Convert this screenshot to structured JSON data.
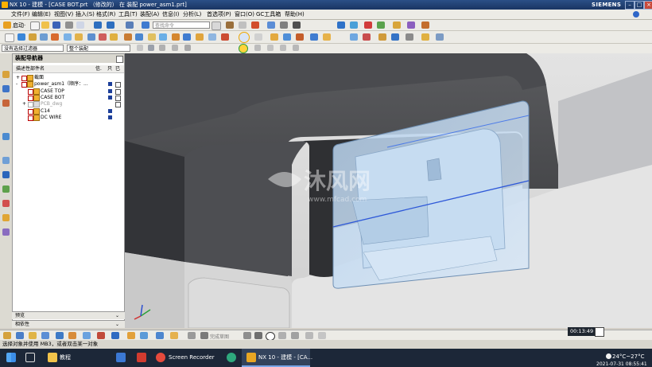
{
  "window": {
    "title": "NX 10 - 建模 - [CASE BOT.prt （修改的） 在 装配 power_asm1.prt]",
    "brand": "SIEMENS"
  },
  "menu": [
    "文件(F)",
    "编辑(E)",
    "视图(V)",
    "插入(S)",
    "格式(R)",
    "工具(T)",
    "装配(A)",
    "信息(I)",
    "分析(L)",
    "首选项(P)",
    "窗口(O)",
    "GC工具箱",
    "帮助(H)"
  ],
  "toolbar": {
    "start_label": "启动·",
    "search_placeholder": "查找命令",
    "selection_filter": "没有选择过滤器",
    "assembly_filter": "整个装配"
  },
  "navigator": {
    "title": "装配导航器",
    "columns": [
      "描述性部件名",
      "信.",
      "只",
      "已"
    ],
    "rows": [
      {
        "indent": 0,
        "expander": "+",
        "label": "截面",
        "grey": false,
        "c1": false,
        "c2": false
      },
      {
        "indent": 0,
        "expander": "-",
        "label": "power_asm1（顺序：...",
        "grey": false,
        "c1": true,
        "c2": true
      },
      {
        "indent": 1,
        "expander": "",
        "label": "CASE TOP",
        "grey": false,
        "c1": true,
        "c2": true
      },
      {
        "indent": 1,
        "expander": "",
        "label": "CASE BOT",
        "grey": false,
        "c1": true,
        "c2": true
      },
      {
        "indent": 1,
        "expander": "+",
        "label": "PCB_dwg",
        "grey": true,
        "c1": false,
        "c2": false
      },
      {
        "indent": 1,
        "expander": "",
        "label": "C14",
        "grey": false,
        "c1": true,
        "c2": false
      },
      {
        "indent": 1,
        "expander": "",
        "label": "DC WIRE",
        "grey": false,
        "c1": true,
        "c2": false
      }
    ],
    "preview_label": "预览",
    "dependency_label": "相依性"
  },
  "watermark": {
    "main": "沐风网",
    "sub": "www.mfcad.com"
  },
  "bottom_toolbar": {
    "snap_label": "完成草图"
  },
  "status_text": "选择对象并使用 MB3，或者双击某一对象",
  "clock_overlay": "00:13:49",
  "taskbar": {
    "items": [
      "教程",
      "Screen Recorder",
      "NX 10 - 建模 - [CA..."
    ],
    "weather": "24°C~27°C",
    "datetime": "2021-07-31 08:55:41"
  },
  "colors": {
    "title_bg": "#1f3a6c",
    "glass": "#a9c9e8",
    "dark_body": "#3e3f42"
  }
}
